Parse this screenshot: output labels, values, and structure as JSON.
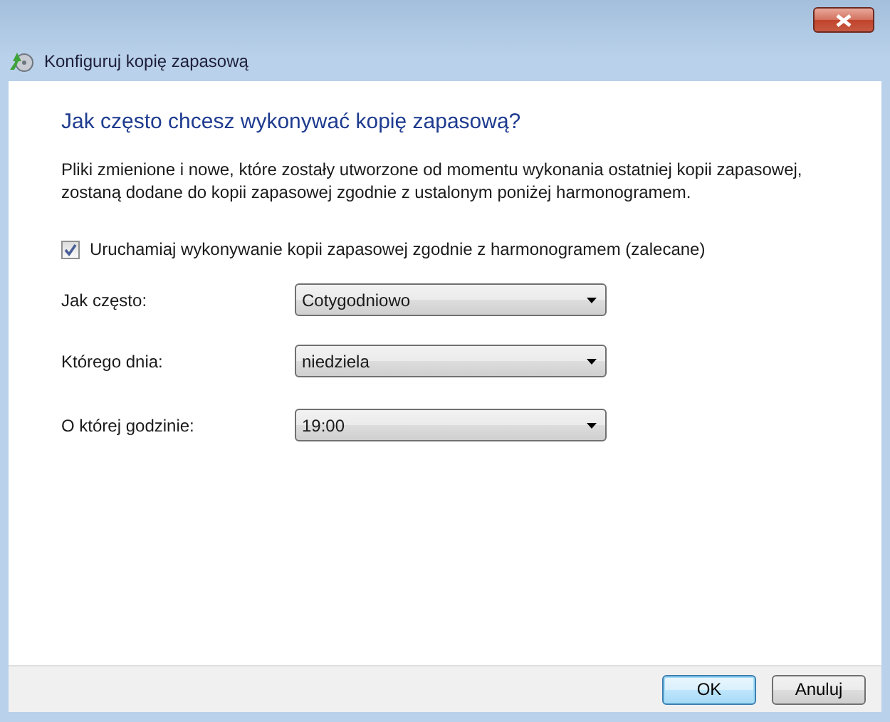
{
  "window": {
    "title": "Konfiguruj kopię zapasową"
  },
  "heading": "Jak często chcesz wykonywać kopię zapasową?",
  "description": "Pliki zmienione i nowe, które zostały utworzone od momentu wykonania ostatniej kopii zapasowej, zostaną dodane do kopii zapasowej zgodnie z ustalonym poniżej harmonogramem.",
  "schedule_checkbox": {
    "label": "Uruchamiaj wykonywanie kopii zapasowej zgodnie z harmonogramem (zalecane)",
    "checked": true
  },
  "fields": [
    {
      "label": "Jak często:",
      "value": "Cotygodniowo"
    },
    {
      "label": "Którego dnia:",
      "value": "niedziela"
    },
    {
      "label": "O której godzinie:",
      "value": "19:00"
    }
  ],
  "buttons": [
    {
      "label": "OK",
      "default": true
    },
    {
      "label": "Anuluj",
      "default": false
    }
  ]
}
